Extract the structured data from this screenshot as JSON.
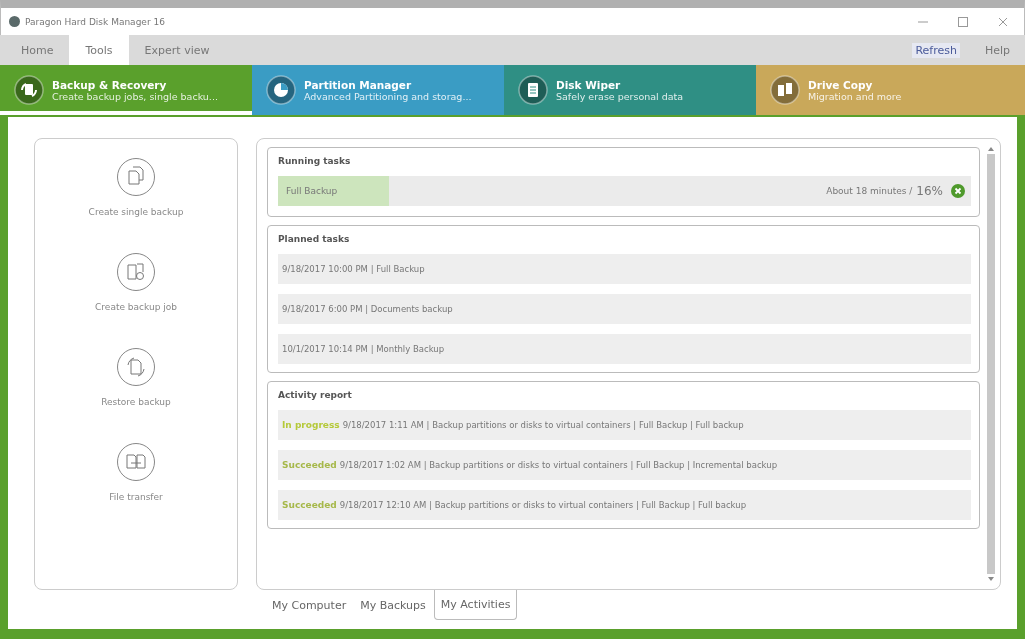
{
  "window": {
    "title": "Paragon Hard Disk Manager 16"
  },
  "menu_tabs": [
    {
      "label": "Home",
      "selected": false
    },
    {
      "label": "Tools",
      "selected": true
    },
    {
      "label": "Expert view",
      "selected": false
    }
  ],
  "menu_links": [
    "Refresh",
    "Help"
  ],
  "modules": [
    {
      "title": "Backup & Recovery",
      "subtitle": "Create backup jobs, single backu...",
      "color": "#5aa02c",
      "kind": "backup",
      "selected": true
    },
    {
      "title": "Partition Manager",
      "subtitle": "Advanced Partitioning and storag...",
      "color": "#3a9cc4",
      "kind": "partition",
      "selected": false
    },
    {
      "title": "Disk Wiper",
      "subtitle": "Safely erase personal data",
      "color": "#2f8f84",
      "kind": "wiper",
      "selected": false
    },
    {
      "title": "Drive Copy",
      "subtitle": "Migration and more",
      "color": "#c9a85a",
      "kind": "copy",
      "selected": false
    }
  ],
  "actions": [
    {
      "label": "Create single backup",
      "kind": "single"
    },
    {
      "label": "Create backup job",
      "kind": "job"
    },
    {
      "label": "Restore backup",
      "kind": "restore"
    },
    {
      "label": "File transfer",
      "kind": "transfer"
    }
  ],
  "running_tasks": {
    "title": "Running tasks",
    "items": [
      {
        "name": "Full Backup",
        "level": 0.16,
        "eta": "About 18 minutes /",
        "percent": "16%"
      }
    ]
  },
  "planned_tasks": {
    "title": "Planned tasks",
    "items": [
      "9/18/2017 10:00 PM | Full Backup",
      "9/18/2017 6:00 PM | Documents backup",
      "10/1/2017 10:14 PM | Monthly Backup"
    ]
  },
  "activity_report": {
    "title": "Activity report",
    "items": [
      {
        "status": "In progress",
        "color": "#b5c93a",
        "text": "9/18/2017 1:11 AM | Backup partitions or disks to virtual containers | Full Backup | Full backup"
      },
      {
        "status": "Succeeded",
        "color": "#a6b84a",
        "text": "9/18/2017 1:02 AM | Backup partitions or disks to virtual containers | Full Backup | Incremental backup"
      },
      {
        "status": "Succeeded",
        "color": "#a6b84a",
        "text": "9/18/2017 12:10 AM | Backup partitions or disks to virtual containers | Full Backup | Full backup"
      }
    ]
  },
  "bottom_tabs": [
    {
      "label": "My Computer",
      "selected": false
    },
    {
      "label": "My Backups",
      "selected": false
    },
    {
      "label": "My Activities",
      "selected": true
    }
  ]
}
